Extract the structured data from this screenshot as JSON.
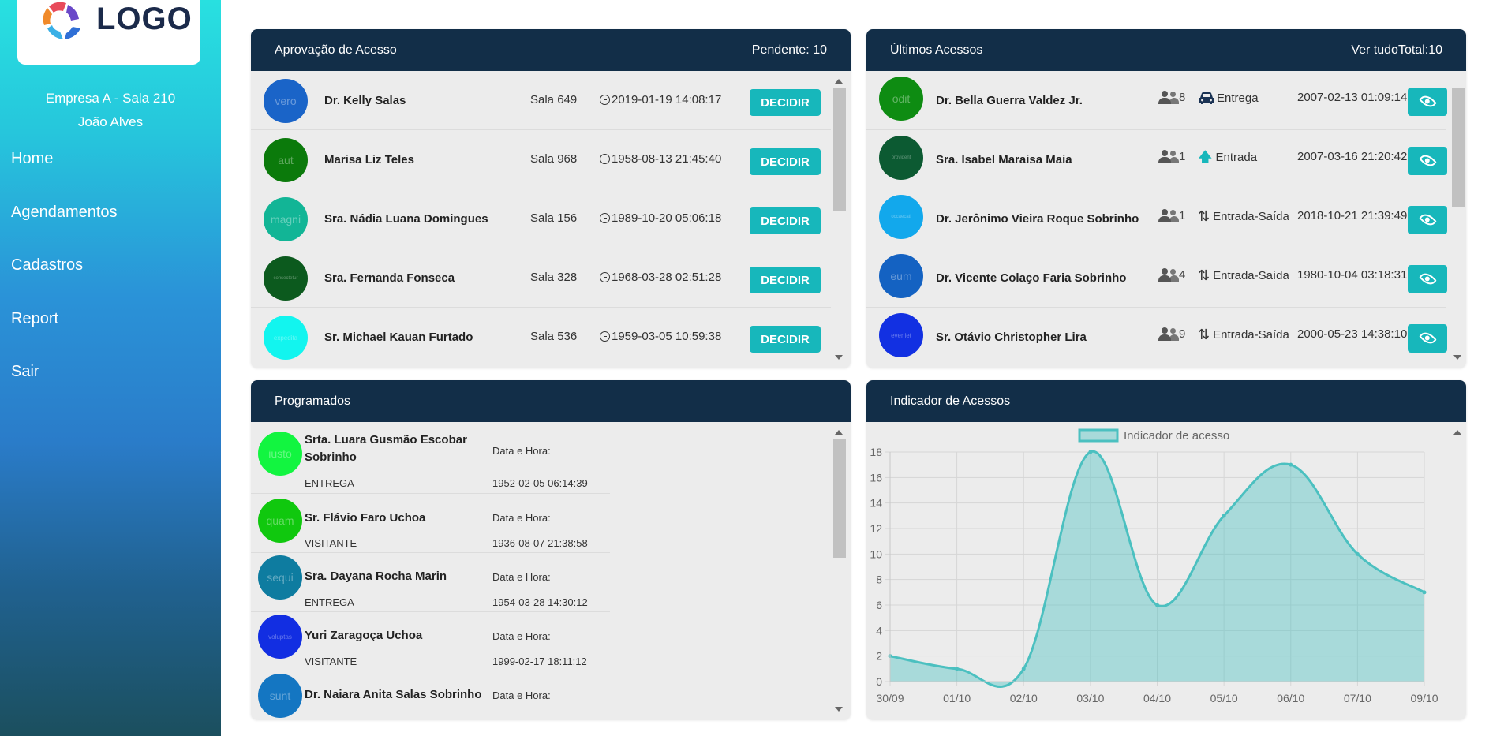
{
  "sidebar": {
    "logo_text": "LOGO",
    "company": "Empresa A - Sala 210",
    "user": "João Alves",
    "nav": [
      {
        "label": "Home"
      },
      {
        "label": "Agendamentos"
      },
      {
        "label": "Cadastros"
      },
      {
        "label": "Report"
      },
      {
        "label": "Sair"
      }
    ]
  },
  "approval": {
    "title": "Aprovação de Acesso",
    "pending": "Pendente: 10",
    "button_label": "DECIDIR",
    "rows": [
      {
        "avatar_text": "vero",
        "avatar_color": "#1a64c8",
        "name": "Dr. Kelly Salas",
        "room": "Sala 649",
        "datetime": "2019-01-19 14:08:17"
      },
      {
        "avatar_text": "aut",
        "avatar_color": "#0b7a0b",
        "name": "Marisa Liz Teles",
        "room": "Sala 968",
        "datetime": "1958-08-13 21:45:40"
      },
      {
        "avatar_text": "magni",
        "avatar_color": "#12b596",
        "name": "Sra. Nádia Luana Domingues",
        "room": "Sala 156",
        "datetime": "1989-10-20 05:06:18"
      },
      {
        "avatar_text": "consectetur",
        "avatar_color": "#0c5a1e",
        "name": "Sra. Fernanda Fonseca",
        "room": "Sala 328",
        "datetime": "1968-03-28 02:51:28"
      },
      {
        "avatar_text": "expedita",
        "avatar_color": "#12f5ef",
        "name": "Sr. Michael Kauan Furtado",
        "room": "Sala 536",
        "datetime": "1959-03-05 10:59:38"
      }
    ]
  },
  "last_access": {
    "title": "Últimos Acessos",
    "see_all": "Ver tudo",
    "total": "Total:10",
    "rows": [
      {
        "avatar_text": "odit",
        "avatar_color": "#0e8c12",
        "name": "Dr. Bella Guerra Valdez Jr.",
        "count": "8",
        "icon": "car-icon",
        "type": "Entrega",
        "datetime": "2007-02-13 01:09:14"
      },
      {
        "avatar_text": "provident",
        "avatar_color": "#0c5a32",
        "name": "Sra. Isabel Maraisa Maia",
        "count": "1",
        "icon": "arrow-up-icon",
        "type": "Entrada",
        "datetime": "2007-03-16 21:20:42"
      },
      {
        "avatar_text": "occaecati",
        "avatar_color": "#12a8ec",
        "name": "Dr. Jerônimo Vieira Roque Sobrinho",
        "count": "1",
        "icon": "arrows-updown-icon",
        "type": "Entrada-Saída",
        "datetime": "2018-10-21 21:39:49"
      },
      {
        "avatar_text": "eum",
        "avatar_color": "#1462c2",
        "name": "Dr. Vicente Colaço Faria Sobrinho",
        "count": "4",
        "icon": "arrows-updown-icon",
        "type": "Entrada-Saída",
        "datetime": "1980-10-04 03:18:31"
      },
      {
        "avatar_text": "eveniet",
        "avatar_color": "#1230e2",
        "name": "Sr. Otávio Christopher Lira",
        "count": "9",
        "icon": "arrows-updown-icon",
        "type": "Entrada-Saída",
        "datetime": "2000-05-23 14:38:10"
      }
    ]
  },
  "scheduled": {
    "title": "Programados",
    "rows": [
      {
        "avatar_text": "iusto",
        "avatar_color": "#12f540",
        "name": "Srta. Luara Gusmão Escobar Sobrinho",
        "type": "ENTREGA",
        "date_label": "Data e Hora:",
        "datetime": "1952-02-05 06:14:39"
      },
      {
        "avatar_text": "quam",
        "avatar_color": "#10c80e",
        "name": "Sr. Flávio Faro Uchoa",
        "type": "VISITANTE",
        "date_label": "Data e Hora:",
        "datetime": "1936-08-07 21:38:58"
      },
      {
        "avatar_text": "sequi",
        "avatar_color": "#0e7ca0",
        "name": "Sra. Dayana Rocha Marin",
        "type": "ENTREGA",
        "date_label": "Data e Hora:",
        "datetime": "1954-03-28 14:30:12"
      },
      {
        "avatar_text": "voluptas",
        "avatar_color": "#122ee2",
        "name": "Yuri Zaragoça Uchoa",
        "type": "VISITANTE",
        "date_label": "Data e Hora:",
        "datetime": "1999-02-17 18:11:12"
      },
      {
        "avatar_text": "sunt",
        "avatar_color": "#1476c2",
        "name": "Dr. Naiara Anita Salas Sobrinho",
        "type": "",
        "date_label": "Data e Hora:",
        "datetime": ""
      }
    ]
  },
  "indicator": {
    "title": "Indicador de Acessos"
  },
  "chart_data": {
    "type": "area",
    "title": "",
    "xlabel": "",
    "ylabel": "",
    "x": [
      "30/09",
      "01/10",
      "02/10",
      "03/10",
      "04/10",
      "05/10",
      "06/10",
      "07/10",
      "09/10"
    ],
    "series": [
      {
        "name": "Indicador de acesso",
        "values": [
          2,
          1,
          1,
          18,
          6,
          13,
          17,
          10,
          7
        ]
      }
    ],
    "ylim": [
      0,
      18
    ],
    "yticks": [
      0,
      2,
      4,
      6,
      8,
      10,
      12,
      14,
      16,
      18
    ],
    "grid": true,
    "legend": "top",
    "color": "#4bc0c0"
  }
}
